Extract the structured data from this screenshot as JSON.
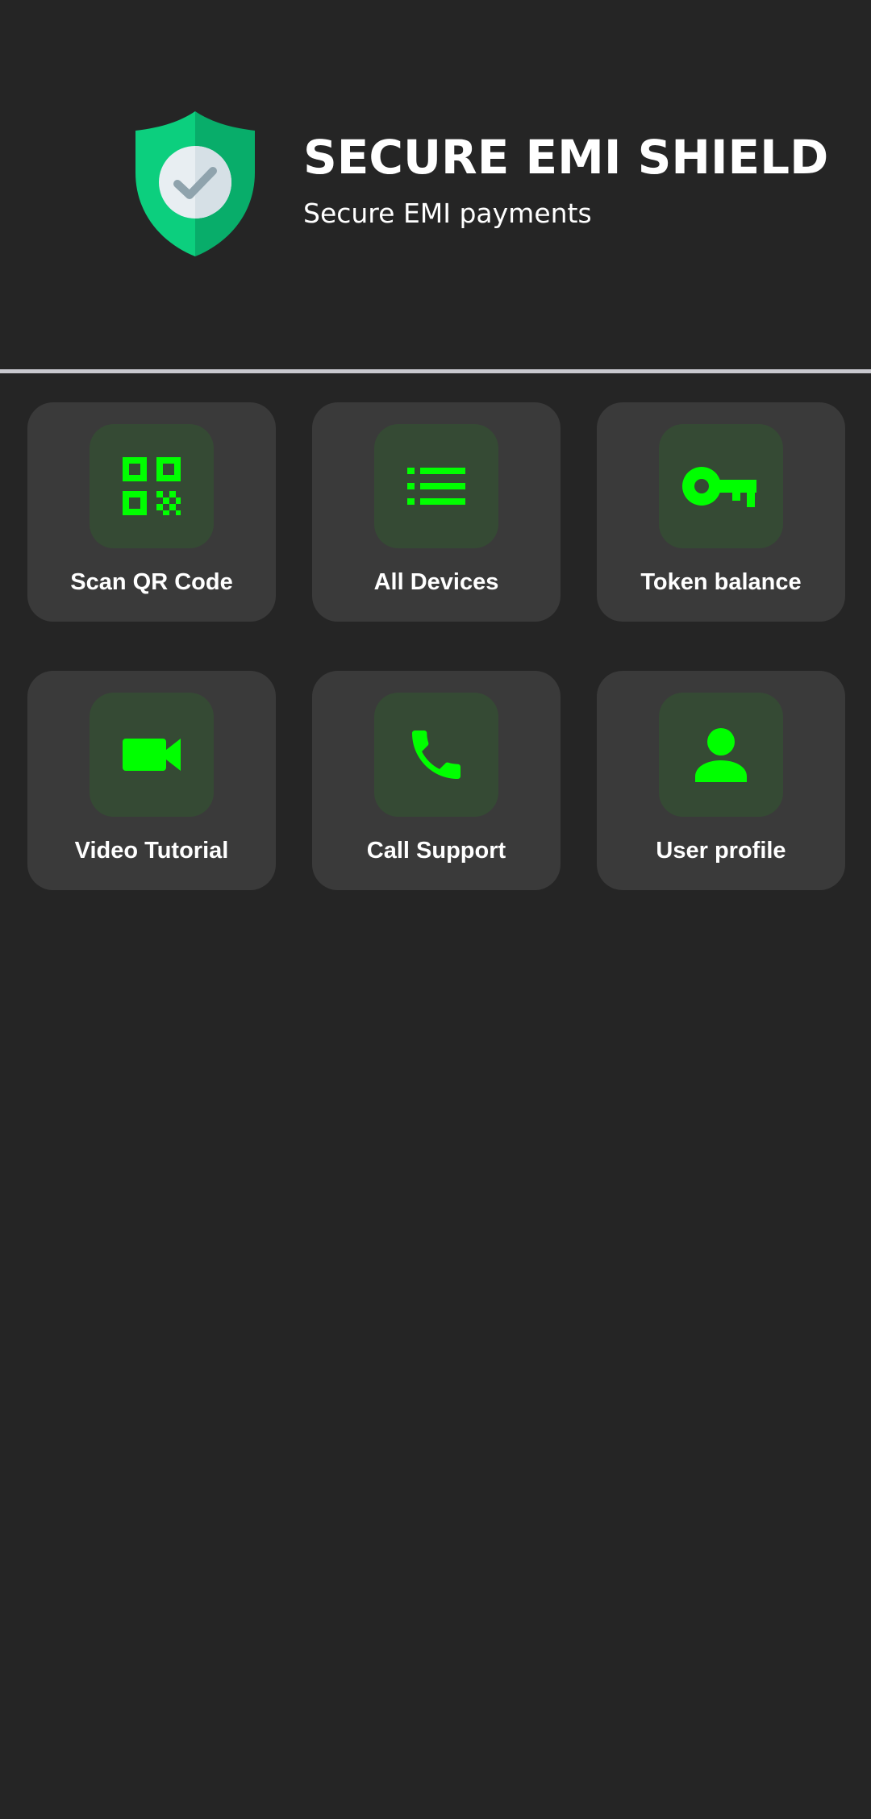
{
  "header": {
    "title": "SECURE EMI SHIELD",
    "subtitle": "Secure EMI payments",
    "logo_icon": "shield-check-icon"
  },
  "colors": {
    "background": "#252525",
    "tile_background": "#3a3a3a",
    "icon_box_background": "#354a34",
    "icon_accent": "#00ff00",
    "divider": "#c9c9cf",
    "shield_primary": "#0ccf7e",
    "shield_secondary": "#08ad6a"
  },
  "tiles": [
    {
      "label": "Scan QR Code",
      "icon": "qr-code-icon"
    },
    {
      "label": "All Devices",
      "icon": "list-icon"
    },
    {
      "label": "Token balance",
      "icon": "key-icon"
    },
    {
      "label": "Video Tutorial",
      "icon": "video-camera-icon"
    },
    {
      "label": "Call Support",
      "icon": "phone-icon"
    },
    {
      "label": "User profile",
      "icon": "user-icon"
    }
  ]
}
